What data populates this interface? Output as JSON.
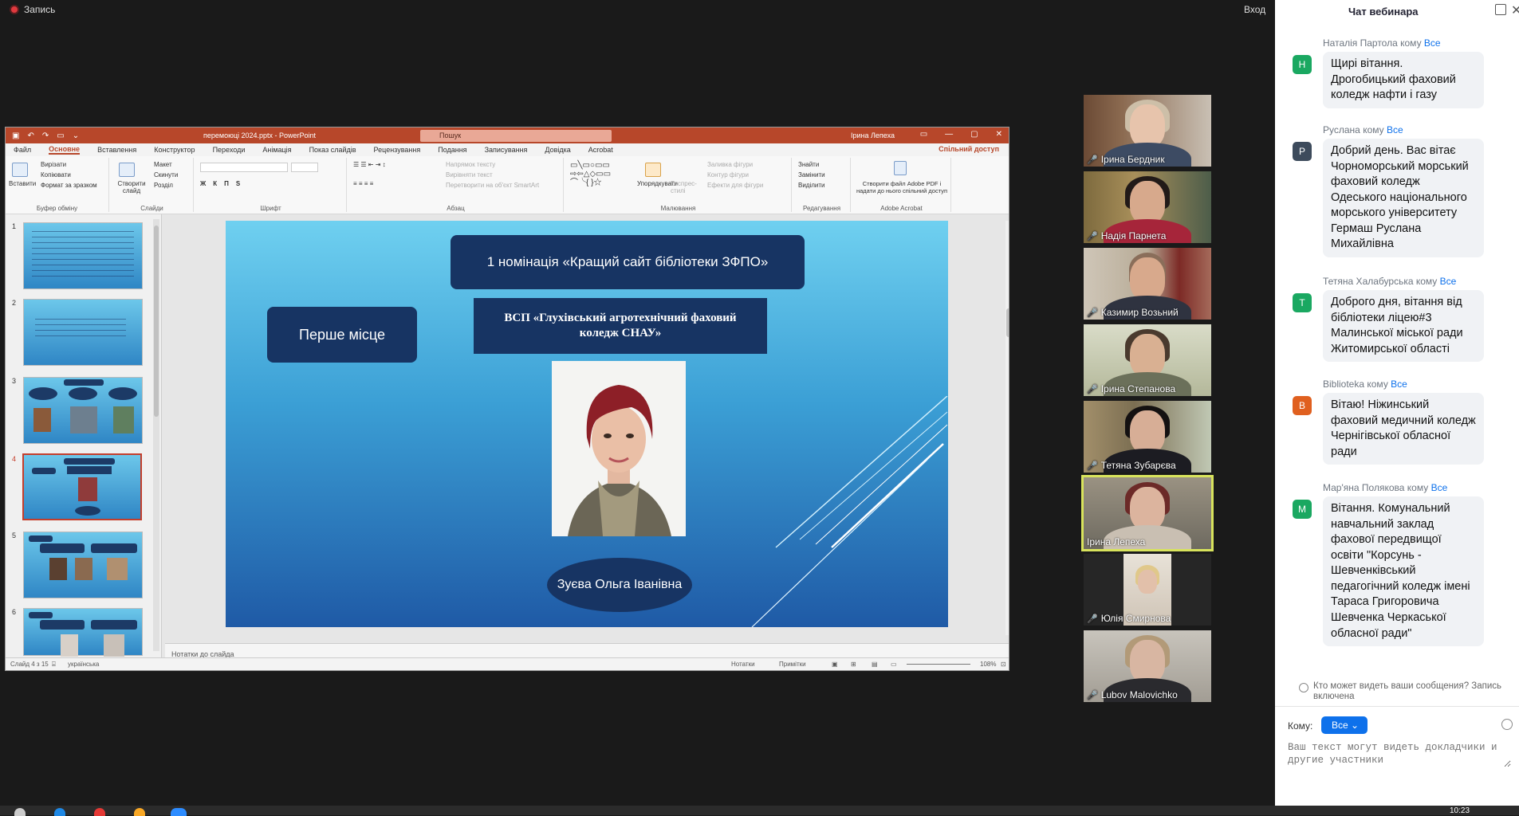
{
  "recording": {
    "label": "Запись"
  },
  "topbar": {
    "login": "Вход"
  },
  "ppt": {
    "title": "перемоюці 2024.pptx - PowerPoint",
    "search_placeholder": "Пошук",
    "user": "Ірина Лепеха",
    "tabs": [
      "Файл",
      "Основне",
      "Вставлення",
      "Конструктор",
      "Переходи",
      "Анімація",
      "Показ слайдів",
      "Рецензування",
      "Подання",
      "Записування",
      "Довідка",
      "Acrobat"
    ],
    "share": "Спільний доступ",
    "ribbon": {
      "paste": "Вставити",
      "cut": "Вирізати",
      "copy": "Копіювати",
      "format_painter": "Формат за зразком",
      "clipboard_group": "Буфер обміну",
      "new_slide": "Створити слайд",
      "layout": "Макет",
      "reset": "Скинути",
      "section": "Розділ",
      "slides_group": "Слайди",
      "font_group": "Шрифт",
      "text_direction": "Напрямок тексту",
      "align_text": "Вирівняти текст",
      "convert_smartart": "Перетворити на об'єкт SmartArt",
      "paragraph_group": "Абзац",
      "arrange": "Упорядкувати",
      "quick_styles": "Експрес-стилі",
      "shape_fill": "Заливка фігури",
      "shape_outline": "Контур фігури",
      "shape_effects": "Ефекти для фігури",
      "drawing_group": "Малювання",
      "find": "Знайти",
      "replace": "Замінити",
      "select": "Виділити",
      "editing_group": "Редагування",
      "create_pdf": "Створити файл Adobe PDF і надати до нього спільний доступ",
      "acrobat_group": "Adobe Acrobat"
    },
    "slide": {
      "nomination": "1 номінація «Кращий сайт бібліотеки ЗФПО»",
      "place": "Перше місце",
      "org": "ВСП «Глухівський агротехнічний фаховий коледж СНАУ»",
      "name": "Зуєва Ольга Іванівна"
    },
    "thumb_numbers": [
      "1",
      "2",
      "3",
      "4",
      "5",
      "6"
    ],
    "notes_placeholder": "Нотатки до слайда",
    "status": {
      "slide_count": "Слайд 4 з 15",
      "language": "українська",
      "notes": "Нотатки",
      "comments": "Примітки",
      "zoom": "108%"
    }
  },
  "participants": [
    {
      "name": "Ірина Бердник"
    },
    {
      "name": "Надія Парнета"
    },
    {
      "name": "Казимир Возьний"
    },
    {
      "name": "Ірина Степанова"
    },
    {
      "name": "Тетяна Зубарєва"
    },
    {
      "name": "Ірина Лепеха"
    },
    {
      "name": "Юлія Смирнова"
    },
    {
      "name": "Lubov Malovichko"
    }
  ],
  "chat": {
    "title": "Чат вебинара",
    "to_word": "кому",
    "messages": [
      {
        "sender": "Наталія Партола",
        "to": "Все",
        "initial": "Н",
        "color": "#1aa861",
        "text": "Щирі вітання. Дрогобицький фаховий коледж нафти і газу"
      },
      {
        "sender": "Руслана",
        "to": "Все",
        "initial": "Р",
        "color": "#3d4b5c",
        "text": "Добрий день. Вас вітає Чорноморський морський фаховий коледж Одеського національного морського університету Гермаш Руслана Михайлівна"
      },
      {
        "sender": "Тетяна Халабурська",
        "to": "Все",
        "initial": "Т",
        "color": "#1aa861",
        "text": "Доброго дня, вітання від бібліотеки ліцею#3 Малинської міської ради Житомирської області"
      },
      {
        "sender": "Biblioteka",
        "to": "Все",
        "initial": "B",
        "color": "#e0601f",
        "text": "Вітаю! Ніжинський фаховий медичний коледж Чернігівської обласної ради"
      },
      {
        "sender": "Мар'яна Полякова",
        "to": "Все",
        "initial": "М",
        "color": "#1aa861",
        "text": "Вітання. Комунальний навчальний заклад фахової передвищої освіти \"Корсунь - Шевченківський педагогічний коледж імені Тараса Григоровича Шевченка Черкаської обласної ради\""
      }
    ],
    "who_can_see": "Кто может видеть ваши сообщения? Запись включена",
    "to_label": "Кому:",
    "to_value": "Все",
    "input_placeholder": "Ваш текст могут видеть докладчики и другие участники"
  },
  "taskbar": {
    "time": "10:23"
  }
}
